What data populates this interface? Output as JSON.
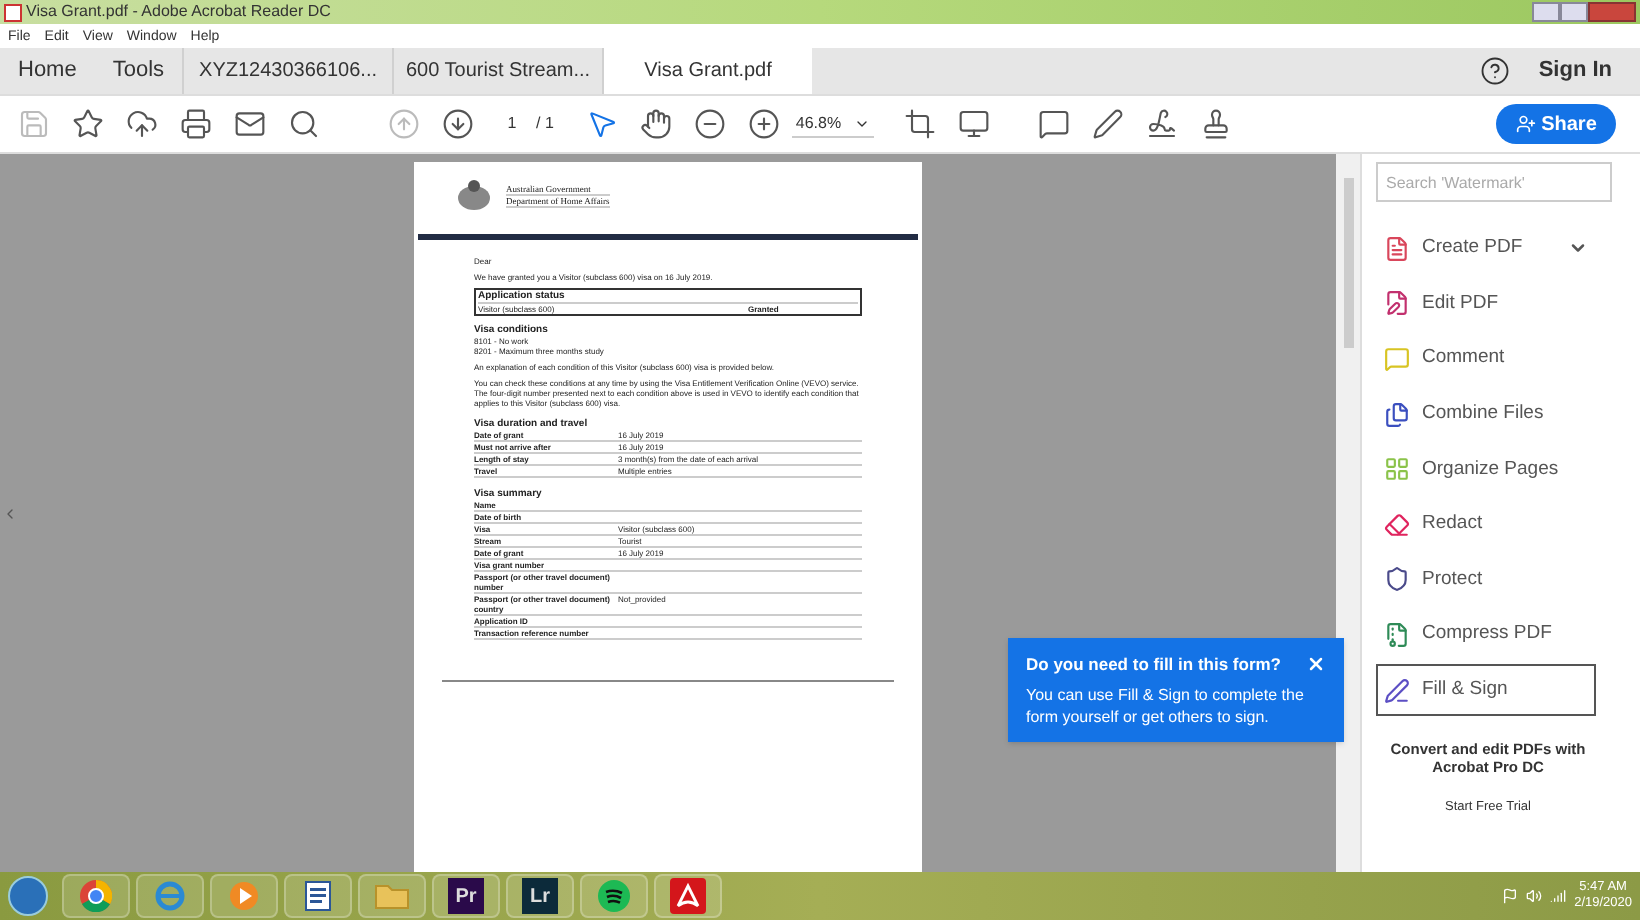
{
  "window": {
    "title": "Visa Grant.pdf - Adobe Acrobat Reader DC"
  },
  "menu": [
    "File",
    "Edit",
    "View",
    "Window",
    "Help"
  ],
  "nav": [
    "Home",
    "Tools"
  ],
  "tabs": [
    {
      "label": "XYZ12430366106...",
      "selected": false
    },
    {
      "label": "600 Tourist Stream...",
      "selected": false
    },
    {
      "label": "Visa Grant.pdf",
      "selected": true
    }
  ],
  "sign_in": "Sign In",
  "toolbar": {
    "page": "1",
    "pages": "/ 1",
    "zoom": "46.8%",
    "share": "Share"
  },
  "document": {
    "header": [
      "Australian Government",
      "Department of Home Affairs"
    ],
    "greeting": "Dear",
    "intro": "We have granted you a Visitor (subclass 600) visa on 16 July 2019.",
    "status": {
      "title": "Application status",
      "visa": "Visitor (subclass 600)",
      "result": "Granted"
    },
    "conditions_title": "Visa conditions",
    "conditions": [
      "8101 - No work",
      "8201 - Maximum three months study"
    ],
    "paragraphs": [
      "An explanation of each condition of this Visitor (subclass 600) visa is provided below.",
      "You can check these conditions at any time by using the Visa Entitlement Verification Online (VEVO) service. The four-digit number presented next to each condition above is used in VEVO to identify each condition that applies to this Visitor (subclass 600) visa."
    ],
    "sections": [
      {
        "title": "Visa duration and travel",
        "rows": [
          [
            "Date of grant",
            "16 July 2019"
          ],
          [
            "Must not arrive after",
            "16 July 2019"
          ],
          [
            "Length of stay",
            "3 month(s) from the date of each arrival"
          ],
          [
            "Travel",
            "Multiple entries"
          ]
        ]
      },
      {
        "title": "Visa summary",
        "rows": [
          [
            "Name",
            ""
          ],
          [
            "Date of birth",
            ""
          ],
          [
            "Visa",
            "Visitor (subclass 600)"
          ],
          [
            "Stream",
            "Tourist"
          ],
          [
            "Date of grant",
            "16 July 2019"
          ],
          [
            "Visa grant number",
            ""
          ],
          [
            "Passport (or other travel document) number",
            ""
          ],
          [
            "Passport (or other travel document) country",
            "Not_provided"
          ],
          [
            "Application ID",
            ""
          ],
          [
            "Transaction reference number",
            ""
          ]
        ]
      }
    ]
  },
  "popup": {
    "title": "Do you need to fill in this form?",
    "body": "You can use Fill & Sign to complete the form yourself or get others to sign."
  },
  "tools_panel": {
    "search": {
      "placeholder": "Search 'Watermark'"
    },
    "tools": [
      {
        "label": "Create PDF",
        "color": "#d9465b",
        "has_menu": true,
        "selected": false
      },
      {
        "label": "Edit PDF",
        "color": "#c2306e",
        "has_menu": false,
        "selected": false
      },
      {
        "label": "Comment",
        "color": "#d8c423",
        "has_menu": false,
        "selected": false
      },
      {
        "label": "Combine Files",
        "color": "#3b4fbf",
        "has_menu": false,
        "selected": false
      },
      {
        "label": "Organize Pages",
        "color": "#8bc34a",
        "has_menu": false,
        "selected": false
      },
      {
        "label": "Redact",
        "color": "#e0245e",
        "has_menu": false,
        "selected": false
      },
      {
        "label": "Protect",
        "color": "#4a4a8a",
        "has_menu": false,
        "selected": false
      },
      {
        "label": "Compress PDF",
        "color": "#2e8b57",
        "has_menu": false,
        "selected": false
      },
      {
        "label": "Fill & Sign",
        "color": "#5c4fc4",
        "has_menu": false,
        "selected": true
      }
    ],
    "promo": "Convert and edit PDFs with Acrobat Pro DC",
    "trial": "Start Free Trial"
  },
  "taskbar": {
    "apps": [
      {
        "kind": "chrome"
      },
      {
        "kind": "ie"
      },
      {
        "kind": "media"
      },
      {
        "kind": "word"
      },
      {
        "kind": "folder"
      },
      {
        "kind": "text",
        "label": "Pr",
        "color": "#2a0a4a"
      },
      {
        "kind": "text",
        "label": "Lr",
        "color": "#0c2a3a"
      },
      {
        "kind": "spotify"
      },
      {
        "kind": "acrobat"
      }
    ],
    "time": "5:47 AM",
    "date": "2/19/2020"
  }
}
